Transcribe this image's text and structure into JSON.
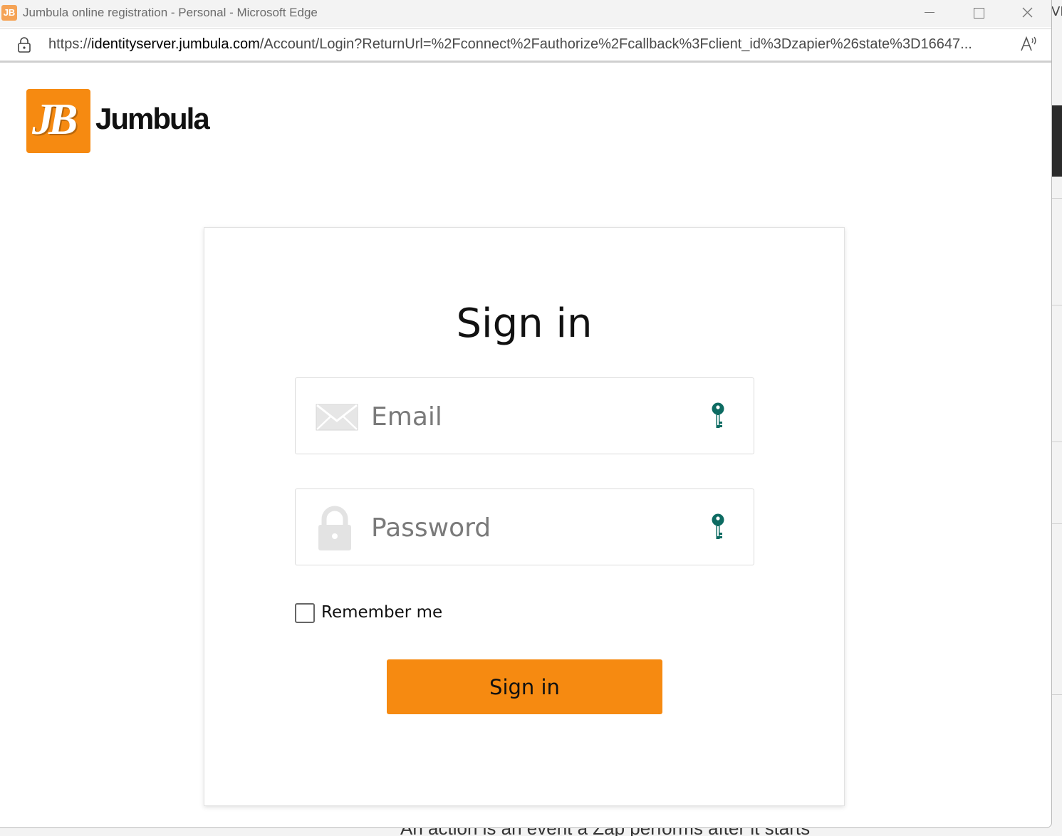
{
  "browser": {
    "favicon_text": "JB",
    "title": "Jumbula online registration - Personal - Microsoft Edge",
    "url_prefix": "https://",
    "url_host": "identityserver.jumbula.com",
    "url_rest": "/Account/Login?ReturnUrl=%2Fconnect%2Fauthorize%2Fcallback%3Fclient_id%3Dzapier%26state%3D16647...",
    "read_aloud_glyph": "A ⁿ"
  },
  "logo": {
    "mark_text": "JB",
    "brand_text": "Jumbula"
  },
  "form": {
    "title": "Sign in",
    "email_placeholder": "Email",
    "password_placeholder": "Password",
    "remember_label": "Remember me",
    "remember_checked": false,
    "submit_label": "Sign in"
  },
  "background": {
    "partial_text": "An action is an event a Zap performs after it starts",
    "edge_text": "VI"
  },
  "colors": {
    "brand_orange": "#f68a11",
    "key_icon_teal": "#0d6b62"
  },
  "icons": {
    "lock": "lock-icon",
    "email": "envelope-icon",
    "password": "padlock-icon",
    "key": "key-icon",
    "minimize": "minimize-icon",
    "maximize": "maximize-icon",
    "close": "close-icon"
  }
}
